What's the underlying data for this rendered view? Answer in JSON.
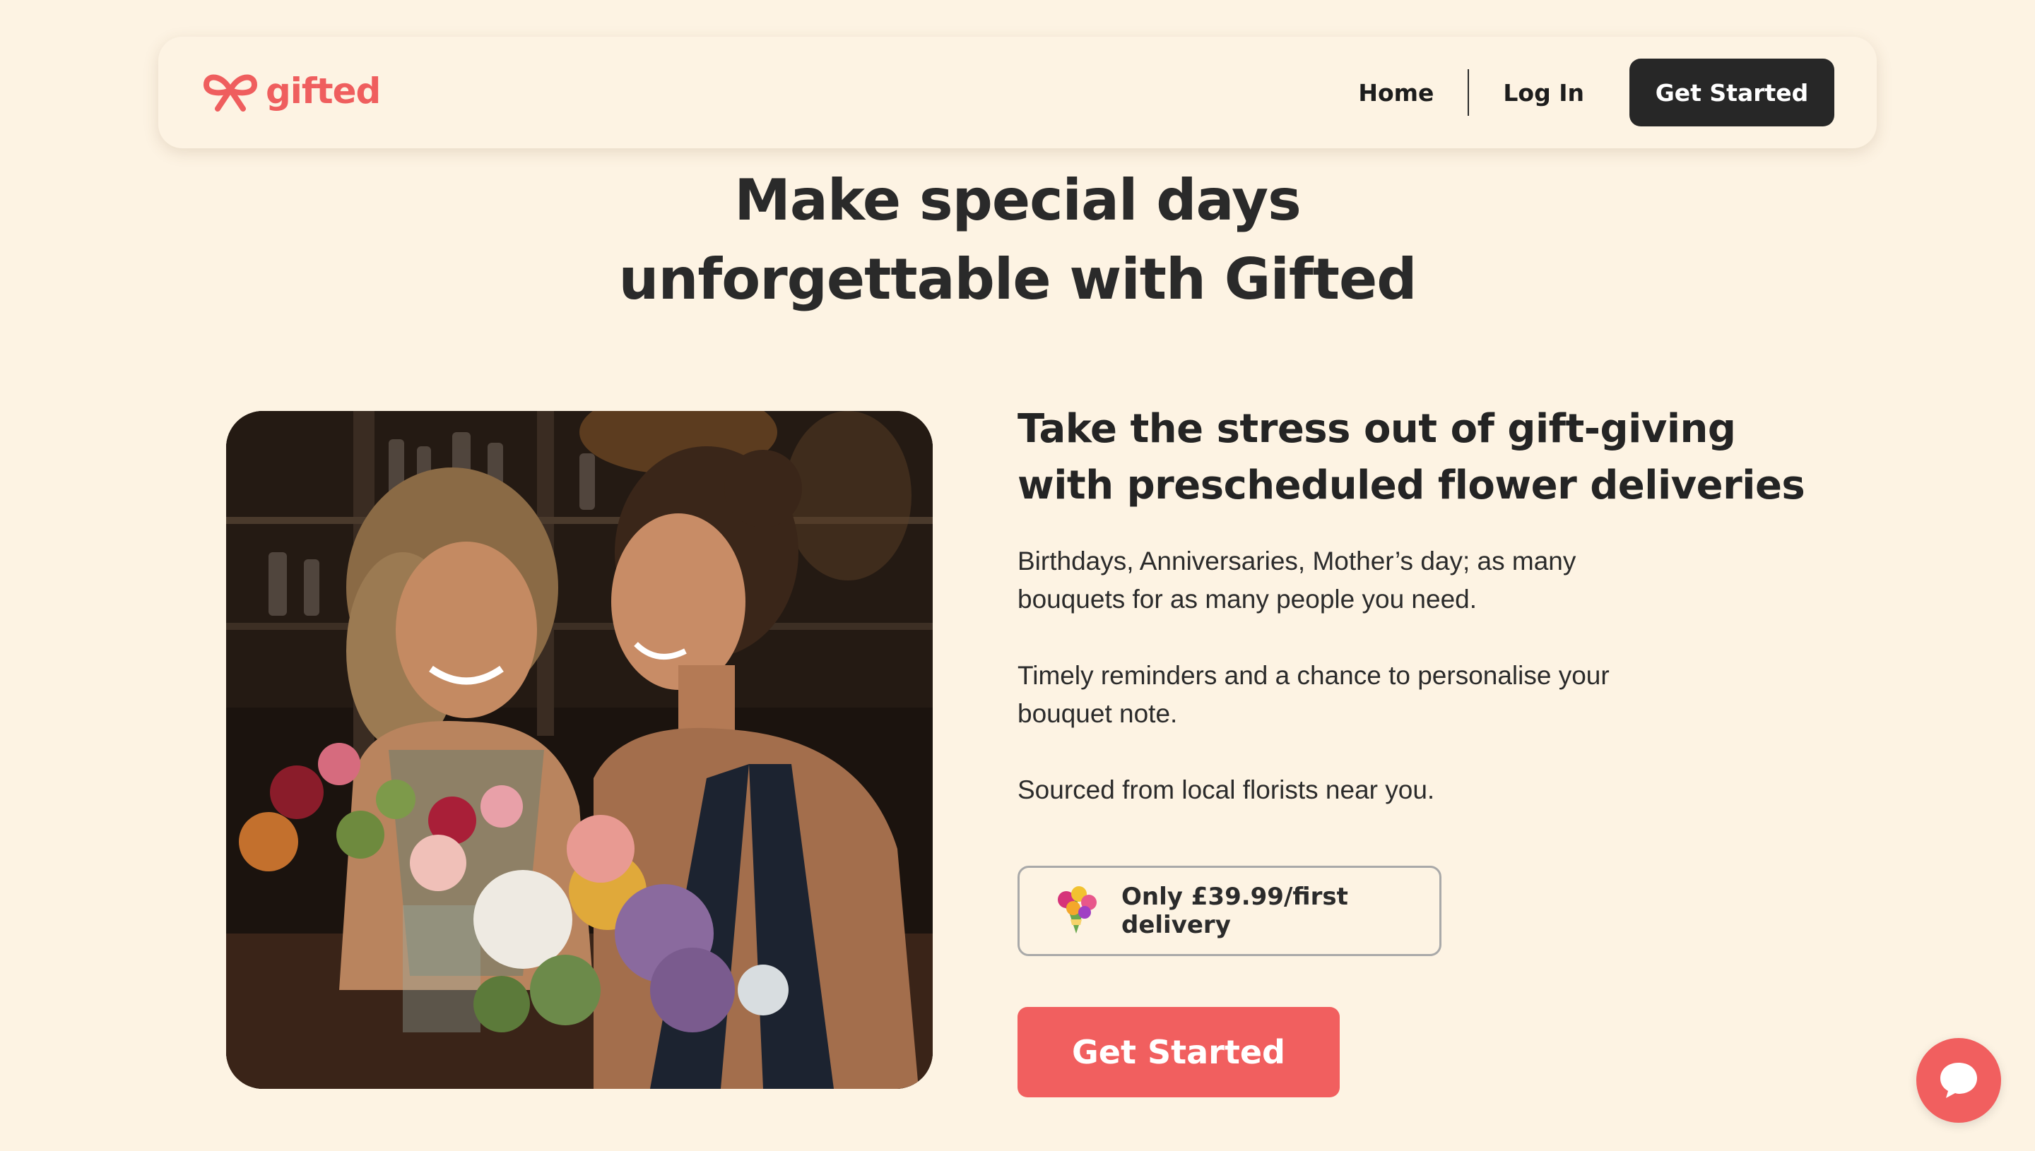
{
  "brand": {
    "name": "gifted",
    "accent_color": "#ef5e5e",
    "dark_color": "#272727",
    "background_color": "#fdf3e3"
  },
  "nav": {
    "home_label": "Home",
    "login_label": "Log In",
    "cta_label": "Get Started"
  },
  "hero": {
    "title_line1": "Make special days",
    "title_line2": "unforgettable with Gifted"
  },
  "image": {
    "description_icon": "two-women-with-flowers-photo"
  },
  "content": {
    "subhead_line1": "Take the stress out of gift-giving",
    "subhead_line2": "with prescheduled flower deliveries",
    "para1_line1": "Birthdays, Anniversaries, Mother’s day; as many",
    "para1_line2": "bouquets for as many people you need.",
    "para2_line1": "Timely reminders and a chance to personalise your",
    "para2_line2": "bouquet note.",
    "para3": "Sourced from local florists near you."
  },
  "pricing": {
    "icon": "bouquet-icon",
    "text": "Only £39.99/first delivery"
  },
  "cta": {
    "label": "Get Started"
  },
  "chat": {
    "icon": "chat-bubble-icon"
  }
}
